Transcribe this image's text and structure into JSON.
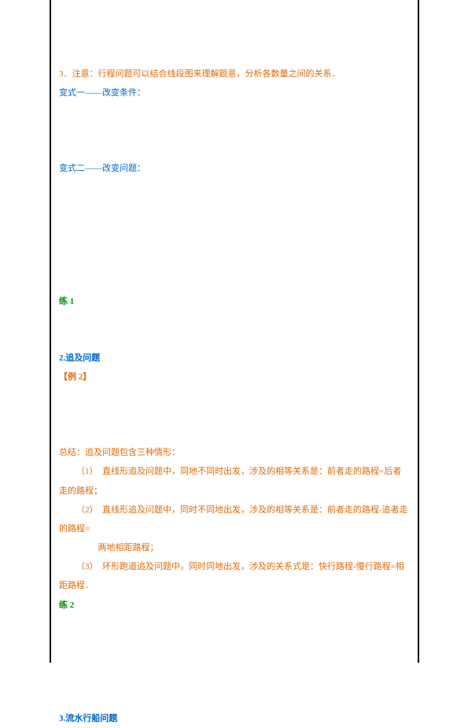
{
  "notes": {
    "line3": "3．注意：行程问题可以结合线段图来理解题意，分析各数量之间的关系．"
  },
  "variant1": {
    "title": "变式一——改变条件："
  },
  "variant2": {
    "title": "变式二——改变问题："
  },
  "practice1": {
    "label": "练 1"
  },
  "section2": {
    "title": "2.追及问题",
    "example_label": "【例 2】"
  },
  "summary": {
    "heading": "总结：追及问题包含三种情形：",
    "item1_num": "（1）",
    "item1": "直线形追及问题中，同地不同时出发，涉及的相等关系是：前者走的路程=后者走的路程；",
    "item2_num": "（2）",
    "item2": "直线形追及问题中，同时不同地出发，涉及的相等关系是：前者走的路程-追者走的路程=",
    "item2b": "两地相距路程；",
    "item3_num": "（3）",
    "item3": "环形跑道追及问题中，同时同地出发，涉及的关系式是：快行路程-慢行路程=相距路程．"
  },
  "practice2": {
    "label": "练 2"
  },
  "section3": {
    "title": "3.流水行船问题"
  }
}
